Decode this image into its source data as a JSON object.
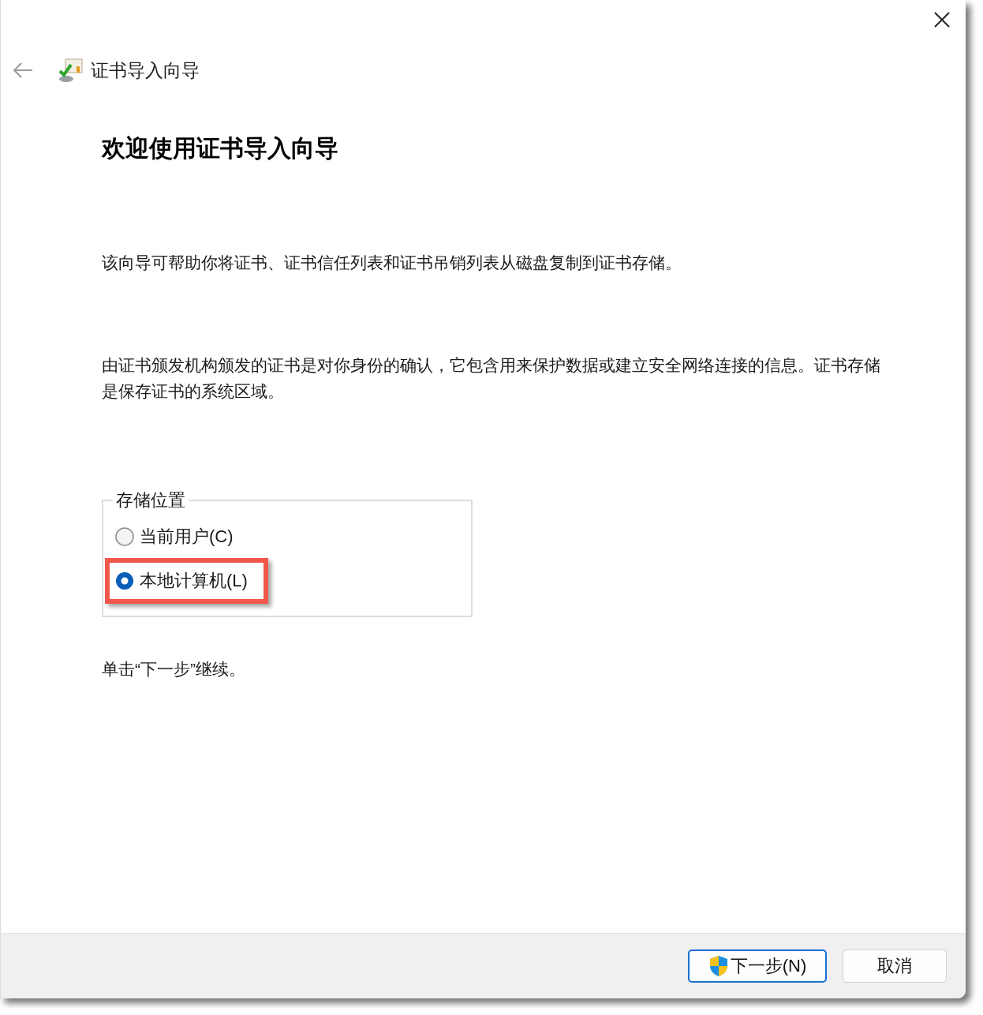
{
  "window": {
    "title": "证书导入向导"
  },
  "heading": "欢迎使用证书导入向导",
  "paragraphs": [
    "该向导可帮助你将证书、证书信任列表和证书吊销列表从磁盘复制到证书存储。",
    "由证书颁发机构颁发的证书是对你身份的确认，它包含用来保护数据或建立安全网络连接的信息。证书存储是保存证书的系统区域。"
  ],
  "store_location": {
    "legend": "存储位置",
    "options": [
      {
        "label": "当前用户(C)",
        "selected": false,
        "highlighted": false
      },
      {
        "label": "本地计算机(L)",
        "selected": true,
        "highlighted": true
      }
    ]
  },
  "hint": "单击“下一步”继续。",
  "buttons": [
    {
      "label": "下一步(N)",
      "kind": "primary"
    },
    {
      "label": "取消",
      "kind": "secondary"
    }
  ]
}
